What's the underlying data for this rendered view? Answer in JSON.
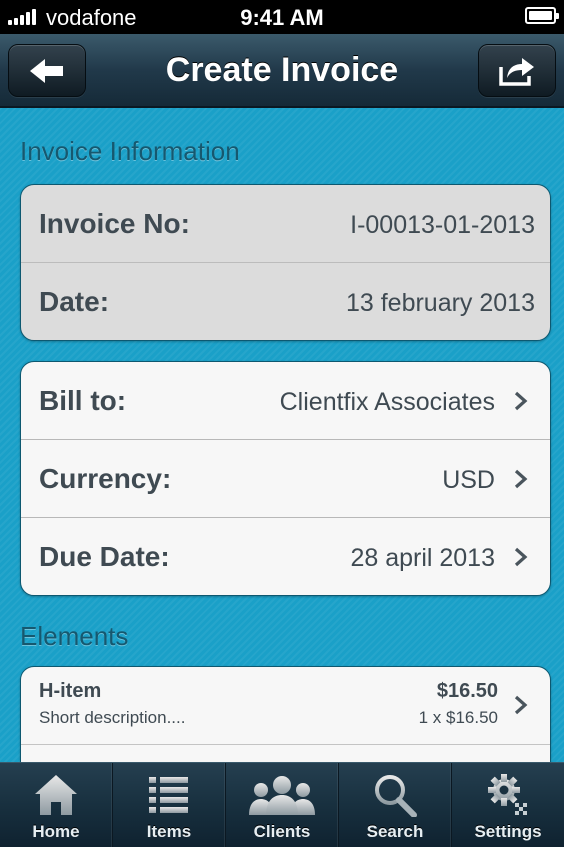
{
  "status_bar": {
    "carrier": "vodafone",
    "time": "9:41 AM"
  },
  "header": {
    "title": "Create Invoice",
    "back_icon": "arrow-left-icon",
    "share_icon": "share-icon"
  },
  "invoice_info": {
    "section_title": "Invoice Information",
    "invoice_no_label": "Invoice No:",
    "invoice_no_value": "I-00013-01-2013",
    "date_label": "Date:",
    "date_value": "13 february 2013"
  },
  "details": {
    "bill_to_label": "Bill to:",
    "bill_to_value": "Clientfix Associates",
    "currency_label": "Currency:",
    "currency_value": "USD",
    "due_date_label": "Due Date:",
    "due_date_value": "28 april 2013"
  },
  "elements": {
    "section_title": "Elements",
    "items": [
      {
        "title": "H-item",
        "description": "Short description....",
        "amount": "$16.50",
        "quantity": "1 x $16.50"
      }
    ]
  },
  "tab_bar": {
    "tabs": [
      {
        "label": "Home",
        "icon": "home-icon"
      },
      {
        "label": "Items",
        "icon": "list-icon"
      },
      {
        "label": "Clients",
        "icon": "people-icon"
      },
      {
        "label": "Search",
        "icon": "search-icon"
      },
      {
        "label": "Settings",
        "icon": "gear-icon"
      }
    ]
  },
  "colors": {
    "background": "#1aa0c8",
    "section_title": "#16586f",
    "text": "#3f4a52",
    "navbar": "#21394a"
  }
}
